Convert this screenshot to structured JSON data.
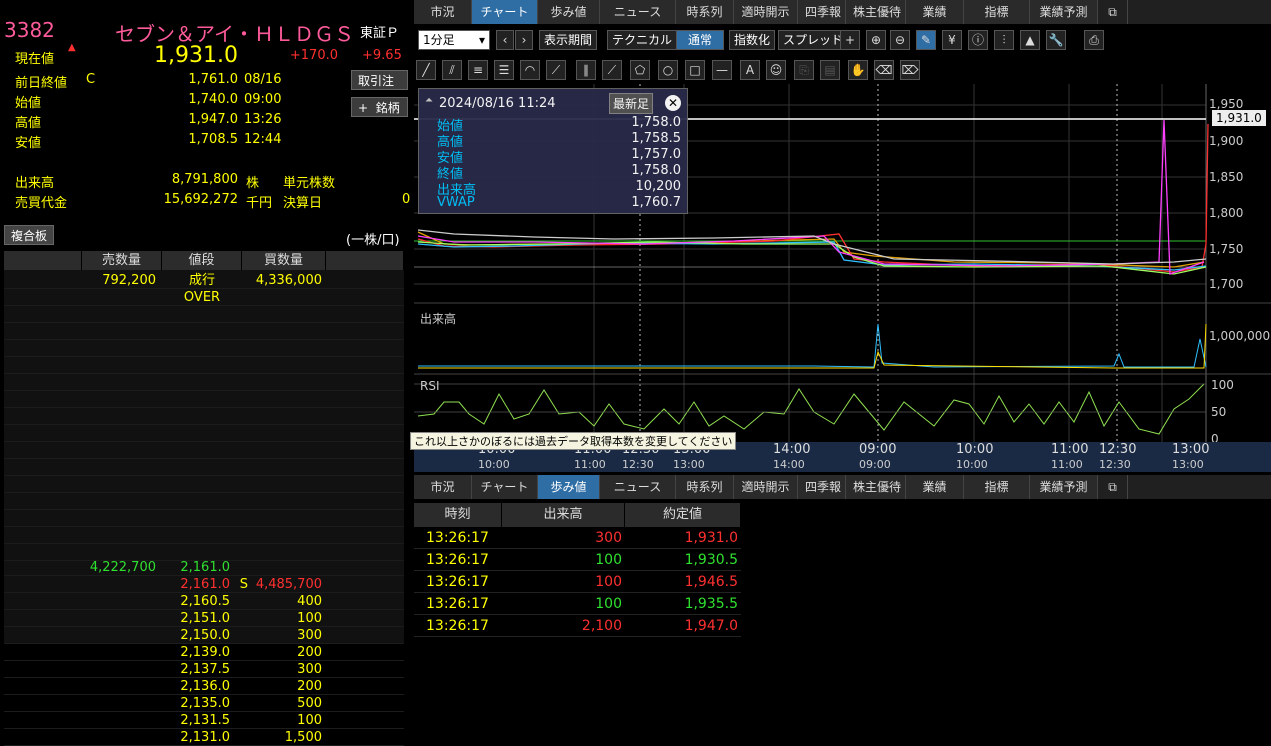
{
  "header": {
    "code": "3382",
    "name": "セブン＆アイ・ＨＬＤＧＳ",
    "market": "東証Ｐ",
    "current_label": "現在値",
    "current_price": "1,931.0",
    "change": "+170.0",
    "change_pct": "+9.65"
  },
  "info": {
    "prev_label": "前日終値",
    "prev_flag": "C",
    "prev_value": "1,761.0",
    "prev_date": "08/16",
    "open_label": "始値",
    "open_value": "1,740.0",
    "open_time": "09:00",
    "high_label": "高値",
    "high_value": "1,947.0",
    "high_time": "13:26",
    "low_label": "安値",
    "low_value": "1,708.5",
    "low_time": "12:44",
    "vol_label": "出来高",
    "vol_value": "8,791,800",
    "vol_unit": "株",
    "unit_shares_label": "単元株数",
    "turnover_label": "売買代金",
    "turnover_value": "15,692,272",
    "turnover_unit": "千円",
    "settle_label": "決算日",
    "settle_value": "0"
  },
  "buttons": {
    "order": "取引注",
    "stock": "銘柄",
    "plus": "+"
  },
  "book": {
    "title": "複合板",
    "unit": "(一株/口)",
    "headers": [
      "売数量",
      "値段",
      "買数量"
    ],
    "market_row": {
      "sell": "792,200",
      "price": "成行",
      "buy": "4,336,000"
    },
    "over": "OVER",
    "bids_top": {
      "sell": "4,222,700",
      "price": "2,161.0"
    },
    "rows": [
      {
        "price": "2,161.0",
        "mark": "S",
        "buy": "4,485,700"
      },
      {
        "price": "2,160.5",
        "mark": "",
        "buy": "400"
      },
      {
        "price": "2,151.0",
        "mark": "",
        "buy": "100"
      },
      {
        "price": "2,150.0",
        "mark": "",
        "buy": "300"
      },
      {
        "price": "2,139.0",
        "mark": "",
        "buy": "200"
      },
      {
        "price": "2,137.5",
        "mark": "",
        "buy": "300"
      },
      {
        "price": "2,136.0",
        "mark": "",
        "buy": "200"
      },
      {
        "price": "2,135.0",
        "mark": "",
        "buy": "500"
      },
      {
        "price": "2,131.5",
        "mark": "",
        "buy": "100"
      },
      {
        "price": "2,131.0",
        "mark": "",
        "buy": "1,500"
      }
    ]
  },
  "tabs_top": [
    "市況",
    "チャート",
    "歩み値",
    "ニュース",
    "時系列",
    "適時開示",
    "四季報",
    "株主優待",
    "業績",
    "指標",
    "業績予測"
  ],
  "tabs_bottom": [
    "市況",
    "チャート",
    "歩み値",
    "ニュース",
    "時系列",
    "適時開示",
    "四季報",
    "株主優待",
    "業績",
    "指標",
    "業績予測"
  ],
  "toolbar": {
    "interval": "1分足",
    "period": "表示期間",
    "technical": "テクニカル",
    "normal": "通常",
    "index": "指数化",
    "spread": "スプレッド"
  },
  "ohlc_box": {
    "datetime": "2024/08/16 11:24",
    "latest": "最新足",
    "rows": [
      {
        "label": "始値",
        "value": "1,758.0"
      },
      {
        "label": "高値",
        "value": "1,758.5"
      },
      {
        "label": "安値",
        "value": "1,757.0"
      },
      {
        "label": "終値",
        "value": "1,758.0"
      },
      {
        "label": "出来高",
        "value": "10,200"
      },
      {
        "label": "VWAP",
        "value": "1,760.7"
      }
    ]
  },
  "chart_axes": {
    "price_ticks": [
      "1,950",
      "1,900",
      "1,850",
      "1,800",
      "1,750",
      "1,700"
    ],
    "last_price": "1,931.0",
    "vol_label": "出来高",
    "vol_tick": "1,000,000",
    "rsi_label": "RSI",
    "rsi_ticks": [
      "100",
      "50",
      "0"
    ],
    "time_upper": [
      "10:00",
      "11:00",
      "12:30",
      "13:00",
      "14:00",
      "09:00",
      "10:00",
      "11:00",
      "12:30",
      "13:00"
    ],
    "time_lower": [
      "10:00",
      "11:00",
      "12:30",
      "13:00",
      "14:00",
      "09:00",
      "10:00",
      "11:00",
      "12:30",
      "13:00"
    ],
    "tooltip": "これ以上さかのぼるには過去データ取得本数を変更してください"
  },
  "ticks": {
    "headers": [
      "時刻",
      "出来高",
      "約定値"
    ],
    "rows": [
      {
        "time": "13:26:17",
        "vol": "300",
        "price": "1,931.0",
        "vc": "r",
        "pc": "r"
      },
      {
        "time": "13:26:17",
        "vol": "100",
        "price": "1,930.5",
        "vc": "g",
        "pc": "g"
      },
      {
        "time": "13:26:17",
        "vol": "100",
        "price": "1,946.5",
        "vc": "r",
        "pc": "r"
      },
      {
        "time": "13:26:17",
        "vol": "100",
        "price": "1,935.5",
        "vc": "g",
        "pc": "g"
      },
      {
        "time": "13:26:17",
        "vol": "2,100",
        "price": "1,947.0",
        "vc": "r",
        "pc": "r"
      }
    ]
  }
}
